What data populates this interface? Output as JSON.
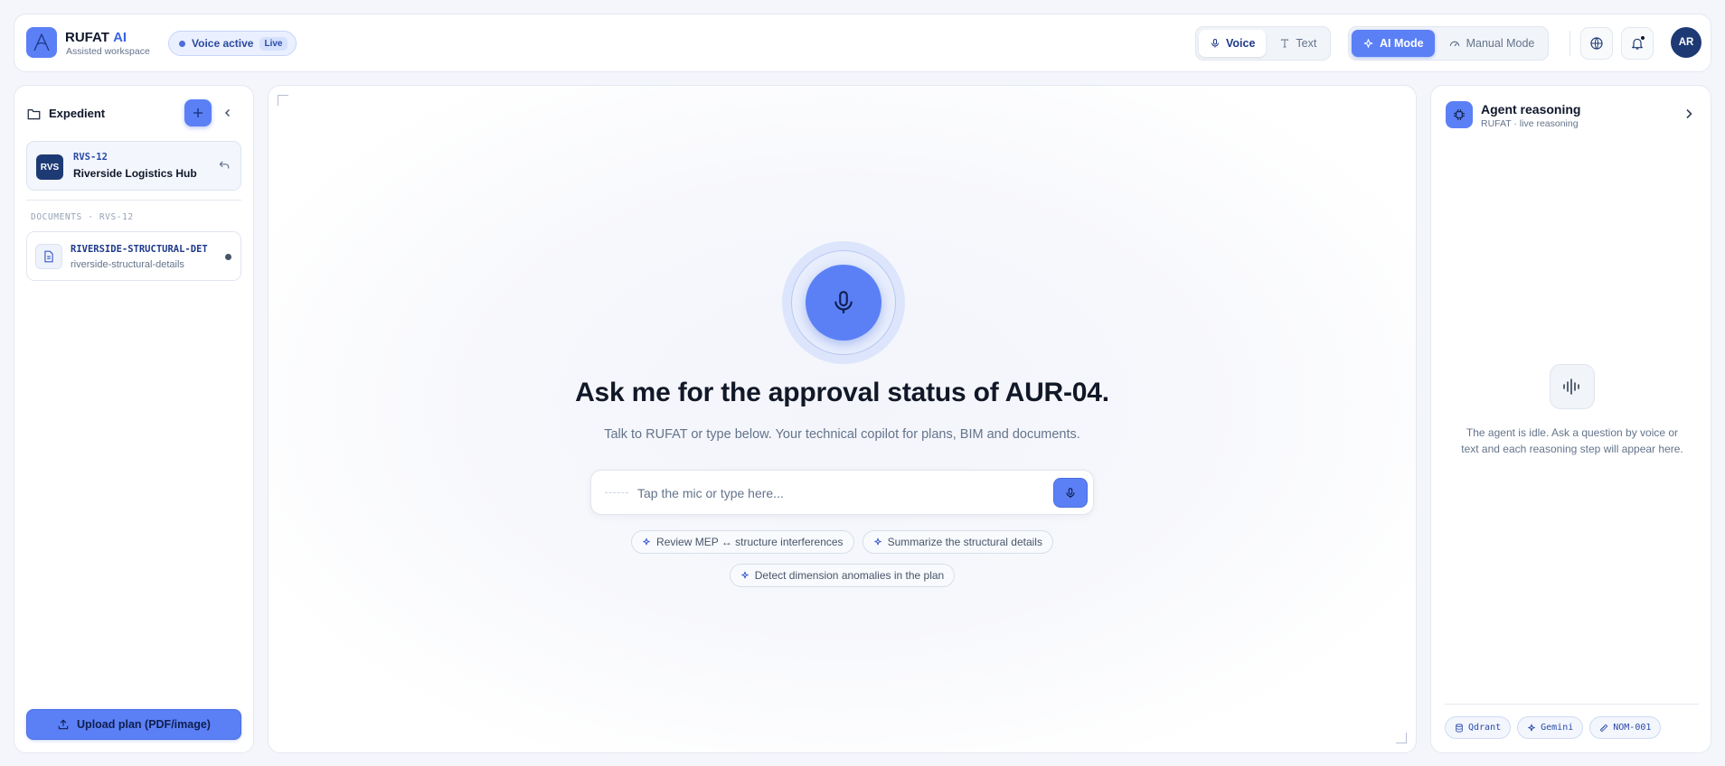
{
  "topbar": {
    "brand": "RUFAT",
    "brand_suffix": "AI",
    "brand_sub": "Assisted workspace",
    "status_label": "Voice active",
    "status_badge": "Live",
    "input_modes": [
      "Voice",
      "Text"
    ],
    "active_input_mode": "Voice",
    "operating_modes": [
      "AI Mode",
      "Manual Mode"
    ],
    "active_operating_mode": "AI Mode",
    "avatar_initials": "AR"
  },
  "sidebar": {
    "title": "Expedient",
    "project": {
      "badge": "RVS",
      "code": "RVS-12",
      "name": "Riverside Logistics Hub"
    },
    "section_label": "DOCUMENTS · RVS-12",
    "documents": [
      {
        "name": "RIVERSIDE-STRUCTURAL-DET",
        "file": "riverside-structural-details"
      }
    ],
    "upload_label": "Upload plan (PDF/image)"
  },
  "main": {
    "headline": "Ask me for the approval status of AUR-04.",
    "subline": "Talk to RUFAT or type below. Your technical copilot for plans, BIM and documents.",
    "input_placeholder": "Tap the mic or type here...",
    "suggestions": [
      "Review MEP ↔ structure interferences",
      "Summarize the structural details",
      "Detect dimension anomalies in the plan"
    ]
  },
  "reasoning": {
    "title": "Agent reasoning",
    "subtitle": "RUFAT · live reasoning",
    "idle_text": "The agent is idle. Ask a question by voice or text and each reasoning step will appear here.",
    "tags": [
      "Qdrant",
      "Gemini",
      "NOM-001"
    ]
  },
  "colors": {
    "accent": "#5b80f6",
    "navy": "#1e3a75",
    "background": "#f4f6fb"
  }
}
